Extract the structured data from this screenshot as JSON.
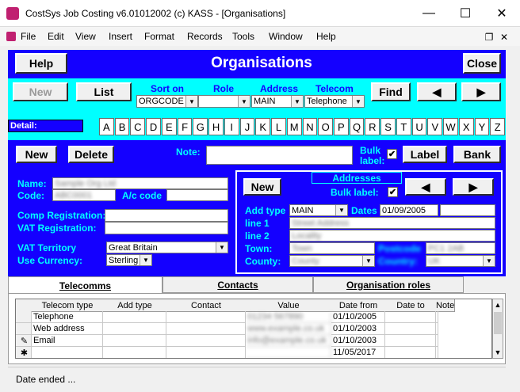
{
  "window": {
    "title": "CostSys Job Costing v6.01012002 (c) KASS - [Organisations]",
    "minimize_glyph": "—",
    "maximize_glyph": "☐",
    "close_glyph": "✕"
  },
  "menu": [
    "File",
    "Edit",
    "View",
    "Insert",
    "Format",
    "Records",
    "Tools",
    "Window",
    "Help"
  ],
  "header": {
    "help_label": "Help",
    "title": "Organisations",
    "close_label": "Close"
  },
  "toolbar": {
    "new_label": "New",
    "list_label": "List",
    "sort_on_label": "Sort on",
    "role_label": "Role",
    "address_label": "Address",
    "telecom_label": "Telecom",
    "sort_on_value": "ORGCODE",
    "role_value": "",
    "address_value": "MAIN",
    "telecom_value": "Telephone",
    "find_label": "Find",
    "prev_glyph": "◀",
    "next_glyph": "▶"
  },
  "detail": {
    "label": "Detail:",
    "letters": [
      "A",
      "B",
      "C",
      "D",
      "E",
      "F",
      "G",
      "H",
      "I",
      "J",
      "K",
      "L",
      "M",
      "N",
      "O",
      "P",
      "Q",
      "R",
      "S",
      "T",
      "U",
      "V",
      "W",
      "X",
      "Y",
      "Z"
    ]
  },
  "actions": {
    "new_label": "New",
    "delete_label": "Delete",
    "note_label": "Note:",
    "bulk_label_text1": "Bulk",
    "bulk_label_text2": "label:",
    "bulk_checked": "✔",
    "label_button": "Label",
    "bank_button": "Bank"
  },
  "org": {
    "name_label": "Name:",
    "code_label": "Code:",
    "name_value": "Sample Org Ltd",
    "code_value": "ABC0001",
    "ac_code_label": "A/c code",
    "comp_reg_label": "Comp Registration:",
    "vat_reg_label": "VAT Registration:",
    "vat_territory_label": "VAT Territory",
    "vat_territory_value": "Great Britain",
    "use_currency_label": "Use Currency:",
    "use_currency_value": "Sterling"
  },
  "addresses": {
    "header": "Addresses",
    "new_label": "New",
    "bulk_label": "Bulk label:",
    "bulk_checked": "✔",
    "add_type_label": "Add type",
    "add_type_value": "MAIN",
    "dates_label": "Dates",
    "date_from": "01/09/2005",
    "date_to": "",
    "line1_label": "line 1",
    "line2_label": "line 2",
    "town_label": "Town:",
    "county_label": "County:",
    "country_label": "Country:",
    "postcode_label": "Postcode",
    "line1_value": "Street Address",
    "line2_value": "Locality",
    "town_value": "Town",
    "postcode_value": "PC1 2AB",
    "county_value": "County",
    "country_value": "UK"
  },
  "tabs": [
    "Telecomms",
    "Contacts",
    "Organisation roles"
  ],
  "grid": {
    "columns": [
      "Telecom type",
      "Add type",
      "Contact",
      "Value",
      "Date from",
      "Date to",
      "Note"
    ],
    "rows": [
      {
        "marker": "",
        "type": "Telephone",
        "add_type": "",
        "contact": "",
        "value": "01234 567890",
        "date_from": "01/10/2005",
        "date_to": "",
        "note": ""
      },
      {
        "marker": "",
        "type": "Web address",
        "add_type": "",
        "contact": "",
        "value": "www.example.co.uk",
        "date_from": "01/10/2003",
        "date_to": "",
        "note": ""
      },
      {
        "marker": "✎",
        "type": "Email",
        "add_type": "",
        "contact": "",
        "value": "info@example.co.uk",
        "date_from": "01/10/2003",
        "date_to": "",
        "note": ""
      },
      {
        "marker": "✱",
        "type": "",
        "add_type": "",
        "contact": "",
        "value": "",
        "date_from": "11/05/2017",
        "date_to": "",
        "note": ""
      }
    ]
  },
  "status": {
    "text": "Date ended ..."
  },
  "colors": {
    "panel_blue": "#1400ff",
    "panel_cyan": "#00ffff"
  }
}
